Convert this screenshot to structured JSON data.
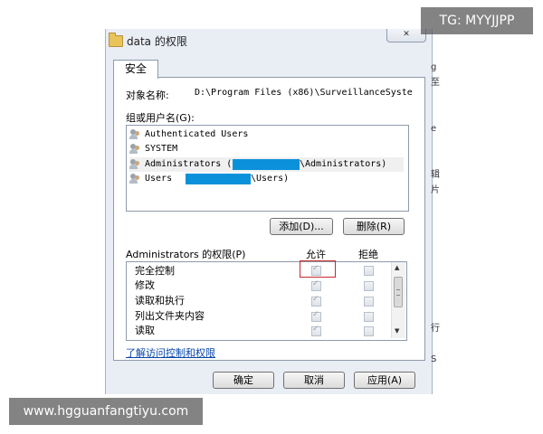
{
  "window": {
    "title": "data 的权限",
    "close_label": "✕"
  },
  "tab": {
    "label": "安全"
  },
  "object": {
    "label": "对象名称:",
    "value": "D:\\Program Files (x86)\\SurveillanceSyste"
  },
  "users": {
    "label": "组或用户名(G):",
    "items": [
      {
        "name": "Authenticated Users"
      },
      {
        "name": "SYSTEM"
      },
      {
        "name": "Administrators (",
        "suffix": "\\Administrators)"
      },
      {
        "name": "Users",
        "suffix": "\\Users)"
      }
    ]
  },
  "buttons": {
    "add": "添加(D)...",
    "remove": "删除(R)",
    "ok": "确定",
    "cancel": "取消",
    "apply": "应用(A)"
  },
  "permissions": {
    "title": "Administrators 的权限(P)",
    "allow_label": "允许",
    "deny_label": "拒绝",
    "rows": [
      {
        "name": "完全控制",
        "allow": true,
        "deny": false
      },
      {
        "name": "修改",
        "allow": true,
        "deny": false
      },
      {
        "name": "读取和执行",
        "allow": true,
        "deny": false
      },
      {
        "name": "列出文件夹内容",
        "allow": true,
        "deny": false
      },
      {
        "name": "读取",
        "allow": true,
        "deny": false
      }
    ]
  },
  "link_text": "了解访问控制和权限",
  "background_chars": [
    "g",
    "至",
    "",
    "",
    "e",
    "",
    "",
    "辑",
    "片",
    "",
    "",
    "",
    "",
    "",
    "",
    "",
    "",
    "行",
    "",
    "S"
  ],
  "watermarks": {
    "top_right": "TG: MYYJJPP",
    "bottom_left": "www.hgguanfangtiyu.com"
  },
  "colors": {
    "redaction": "#0a91da",
    "highlight": "#c8282e",
    "link": "#0645ad"
  }
}
